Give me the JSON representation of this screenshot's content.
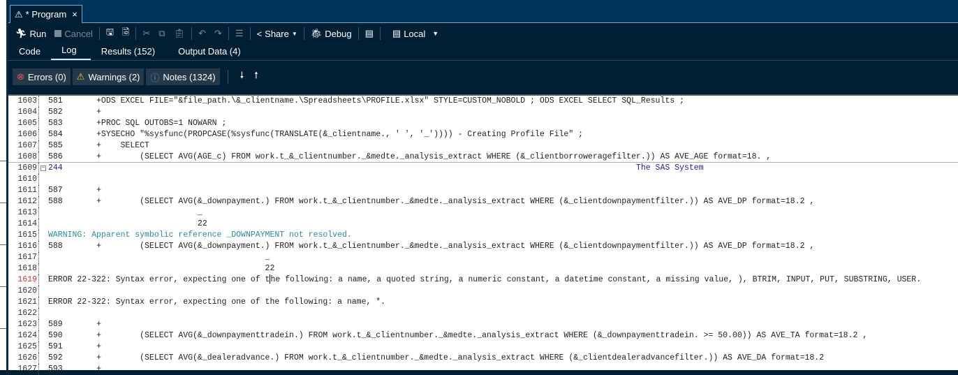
{
  "tab": {
    "title": "* Program",
    "close": "×"
  },
  "toolbar": {
    "run": "Run",
    "cancel": "Cancel",
    "share": "Share",
    "debug": "Debug",
    "server": "Local"
  },
  "views": [
    {
      "label": "Code"
    },
    {
      "label": "Log"
    },
    {
      "label": "Results (152)"
    },
    {
      "label": "Output Data (4)"
    }
  ],
  "filters": {
    "errors": "Errors (0)",
    "warnings": "Warnings (2)",
    "notes": "Notes (1324)"
  },
  "log": {
    "rows": [
      {
        "n": "1603",
        "t": "581       +ODS EXCEL FILE=\"&file_path.\\&_clientname.\\Spreadsheets\\PROFILE.xlsx\" STYLE=CUSTOM_NOBOLD ; ODS EXCEL SELECT SQL_Results ;"
      },
      {
        "n": "1604",
        "t": "582       +"
      },
      {
        "n": "1605",
        "t": "583       +PROC SQL OUTOBS=1 NOWARN ;"
      },
      {
        "n": "1606",
        "t": "584       +SYSECHO \"%sysfunc(PROPCASE(%sysfunc(TRANSLATE(&_clientname., ' ', '_')))) - Creating Profile File\" ;"
      },
      {
        "n": "1607",
        "t": "585       +    SELECT"
      },
      {
        "n": "1608",
        "t": "586       +        (SELECT AVG(AGE_c) FROM work.t_&_clientnumber._&medte._analysis_extract WHERE (&_clientborroweragefilter.)) AS AVE_AGE format=18. ,"
      },
      {
        "n": "1609",
        "t": "244                                                                                                                       The SAS System"
      },
      {
        "n": "1610",
        "t": ""
      },
      {
        "n": "1611",
        "t": "587       +"
      },
      {
        "n": "1612",
        "t": "588       +        (SELECT AVG(&_downpayment.) FROM work.t_&_clientnumber._&medte._analysis_extract WHERE (&_clientdownpaymentfilter.)) AS AVE_DP format=18.2 ,"
      },
      {
        "n": "1613",
        "t": "                               _"
      },
      {
        "n": "1614",
        "t": "                               22"
      },
      {
        "n": "1615",
        "t": "WARNING: Apparent symbolic reference _DOWNPAYMENT not resolved."
      },
      {
        "n": "1616",
        "t": "588       +        (SELECT AVG(&_downpayment.) FROM work.t_&_clientnumber._&medte._analysis_extract WHERE (&_clientdownpaymentfilter.)) AS AVE_DP format=18.2 ,"
      },
      {
        "n": "1617",
        "t": "                                             _"
      },
      {
        "n": "1618",
        "t": "                                             22"
      },
      {
        "n": "1619",
        "t": "ERROR 22-322: Syntax error, expecting one of the following: a name, a quoted string, a numeric constant, a datetime constant, a missing value, ), BTRIM, INPUT, PUT, SUBSTRING, USER."
      },
      {
        "n": "1620",
        "t": ""
      },
      {
        "n": "1621",
        "t": "ERROR 22-322: Syntax error, expecting one of the following: a name, *."
      },
      {
        "n": "1622",
        "t": ""
      },
      {
        "n": "1623",
        "t": "589       +"
      },
      {
        "n": "1624",
        "t": "590       +        (SELECT AVG(&_downpaymenttradein.) FROM work.t_&_clientnumber._&medte._analysis_extract WHERE (&_downpaymenttradein. >= 50.00)) AS AVE_TA format=18.2 ,"
      },
      {
        "n": "1625",
        "t": "591       +"
      },
      {
        "n": "1626",
        "t": "592       +        (SELECT AVG(&_dealeradvance.) FROM work.t_&_clientnumber._&medte._analysis_extract WHERE (&_clientdealeradvancefilter.)) AS AVE_DA format=18.2"
      },
      {
        "n": "1627",
        "t": "593       +"
      }
    ]
  },
  "colors": {
    "tabbar": "#00345a",
    "panel": "#001f35",
    "warning": "#2a8a9e",
    "error_line": "#d03030",
    "header": "#2020a0"
  }
}
